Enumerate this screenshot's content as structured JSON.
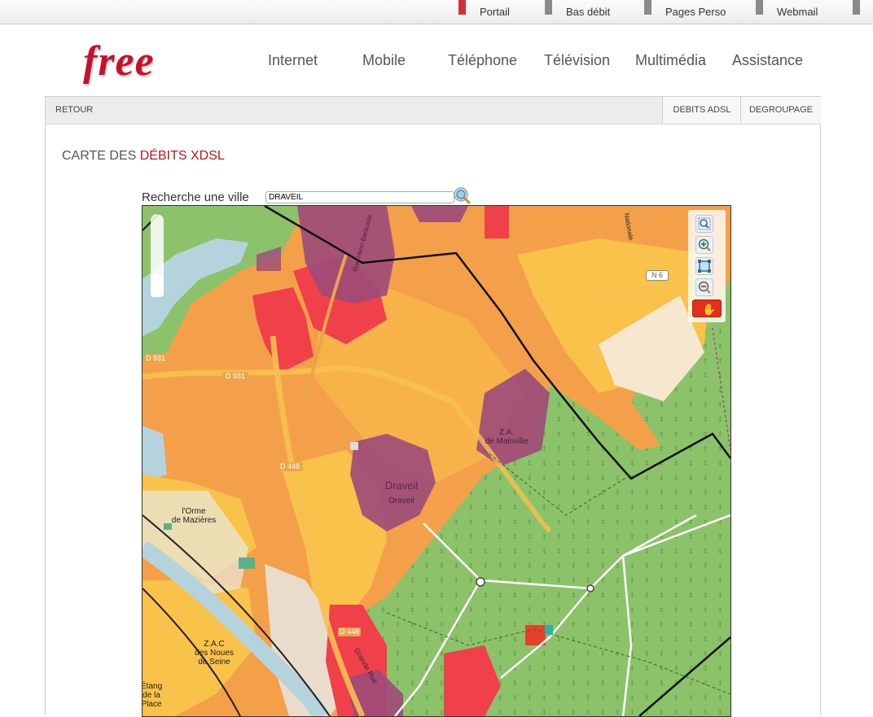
{
  "topbar": {
    "links": [
      {
        "label": "Portail",
        "active": true
      },
      {
        "label": "Bas débit",
        "active": false
      },
      {
        "label": "Pages Perso",
        "active": false
      },
      {
        "label": "Webmail",
        "active": false
      }
    ]
  },
  "header": {
    "logo_text": "free",
    "nav": [
      "Internet",
      "Mobile",
      "Téléphone",
      "Télévision",
      "Multimédia",
      "Assistance"
    ]
  },
  "subnav": {
    "back": "RETOUR",
    "tabs": [
      "DEBITS ADSL",
      "DEGROUPAGE"
    ]
  },
  "page": {
    "title_prefix": "CARTE DES ",
    "title_highlight": "DÉBITS XDSL"
  },
  "search": {
    "label": "Recherche une ville",
    "value": "DRAVEIL"
  },
  "map": {
    "labels": {
      "draveil_big": "Draveil",
      "draveil_small": "Draveil",
      "za_mainville": "Z.A.\nde Mainville",
      "orme": "l'Orme\nde Mazières",
      "zac_noues": "Z.A.C\ndes Noues\nde Seine",
      "etang": "Étang\nde la\nPlace",
      "d931_a": "D 931",
      "d931_b": "D 931",
      "d448_a": "D 448",
      "d448_b": "D 448",
      "n6": "N 6",
      "grande_rue": "Grande Rue",
      "rue_henri_barbusse": "Rue Henri Barbusse",
      "nationale": "Nationale"
    },
    "tools": [
      "zoom-box-icon",
      "zoom-in-icon",
      "fit-extent-icon",
      "zoom-out-icon",
      "pan-hand-icon"
    ],
    "colors": {
      "green": "#8cc26a",
      "yellow": "#f9c24a",
      "orange": "#f4a04a",
      "red": "#f0404a",
      "purple": "#9c4a7a",
      "water": "#b5d3dc"
    }
  }
}
